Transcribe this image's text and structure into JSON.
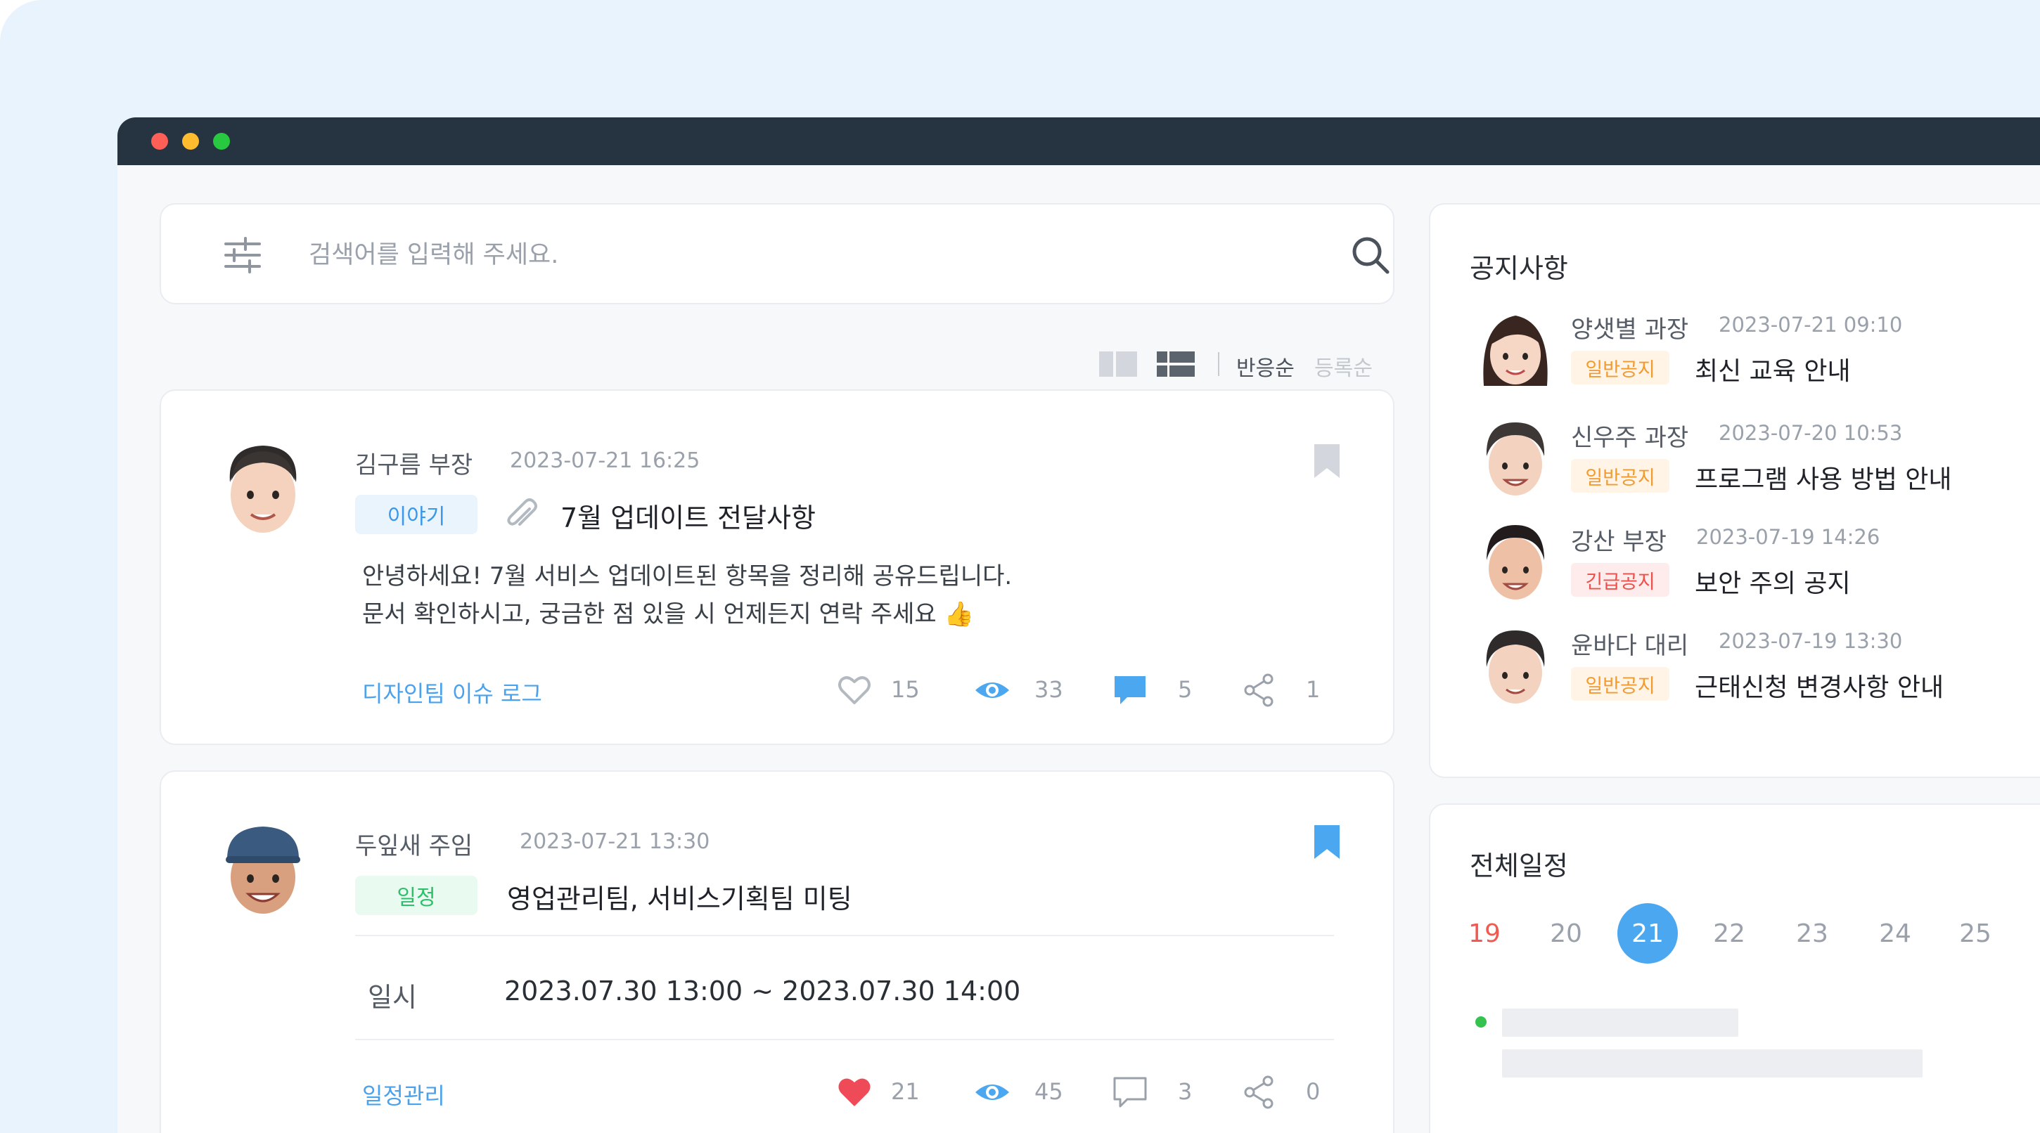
{
  "search": {
    "placeholder": "검색어를 입력해 주세요."
  },
  "sort": {
    "by_reaction": "반응순",
    "by_date": "등록순"
  },
  "posts": [
    {
      "author": "김구름 부장",
      "date": "2023-07-21 16:25",
      "tag": "이야기",
      "title": "7월 업데이트 전달사항",
      "body": [
        "안녕하세요! 7월 서비스 업데이트된 항목을 정리해 공유드립니다.",
        "문서 확인하시고, 궁금한 점 있을 시 언제든지 연락 주세요 👍"
      ],
      "channel": "디자인팀 이슈 로그",
      "likes": "15",
      "views": "33",
      "comments": "5",
      "shares": "1",
      "liked": false,
      "bookmarked": false
    },
    {
      "author": "두잎새 주임",
      "date": "2023-07-21 13:30",
      "tag": "일정",
      "title": "영업관리팀, 서비스기획팀 미팅",
      "field_label": "일시",
      "field_value": "2023.07.30 13:00 ~ 2023.07.30 14:00",
      "channel": "일정관리",
      "likes": "21",
      "views": "45",
      "comments": "3",
      "shares": "0",
      "liked": true,
      "bookmarked": true
    }
  ],
  "notices": {
    "title": "공지사항",
    "items": [
      {
        "author": "양샛별 과장",
        "date": "2023-07-21 09:10",
        "tag": "일반공지",
        "title": "최신 교육 안내"
      },
      {
        "author": "신우주 과장",
        "date": "2023-07-20 10:53",
        "tag": "일반공지",
        "title": "프로그램 사용 방법 안내"
      },
      {
        "author": "강산 부장",
        "date": "2023-07-19 14:26",
        "tag": "긴급공지",
        "title": "보안 주의 공지"
      },
      {
        "author": "윤바다 대리",
        "date": "2023-07-19 13:30",
        "tag": "일반공지",
        "title": "근태신청 변경사항 안내"
      }
    ]
  },
  "schedule": {
    "title": "전체일정",
    "days": [
      "19",
      "20",
      "21",
      "22",
      "23",
      "24",
      "25"
    ],
    "selected": "21"
  },
  "colors": {
    "accent": "#4ba7f0",
    "titlebar": "#263340",
    "like": "#ef4a57",
    "general": "#f29a2e",
    "urgent": "#ef4f4a",
    "event": "#36c24f"
  }
}
